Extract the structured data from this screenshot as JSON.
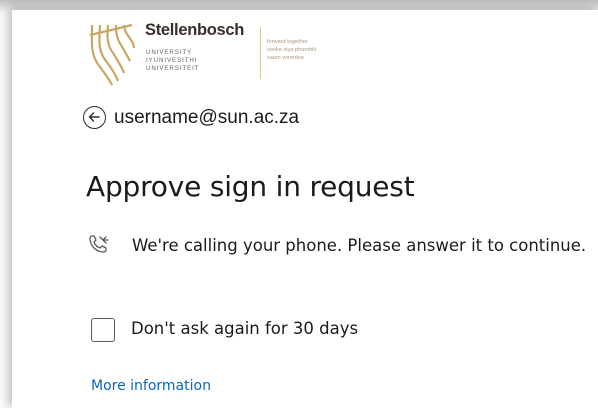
{
  "logo": {
    "name": "Stellenbosch",
    "sub_lines": [
      "UNIVERSITY",
      "IYUNIVESITHI",
      "UNIVERSITEIT"
    ],
    "tagline_lines": [
      "forward together",
      "sonke siya phambili",
      "saam vorentoe"
    ],
    "colors": {
      "mark": "#c8a764",
      "name": "#3b2f2a"
    }
  },
  "identity": {
    "email": "username@sun.ac.za",
    "back_icon": "arrow-left-circle-icon"
  },
  "title": "Approve sign in request",
  "message": {
    "icon": "phone-calling-icon",
    "text": "We're calling your phone. Please answer it to continue."
  },
  "remember": {
    "label": "Don't ask again for 30 days",
    "checked": false
  },
  "link": {
    "label": "More information",
    "color": "#0b67b8"
  }
}
